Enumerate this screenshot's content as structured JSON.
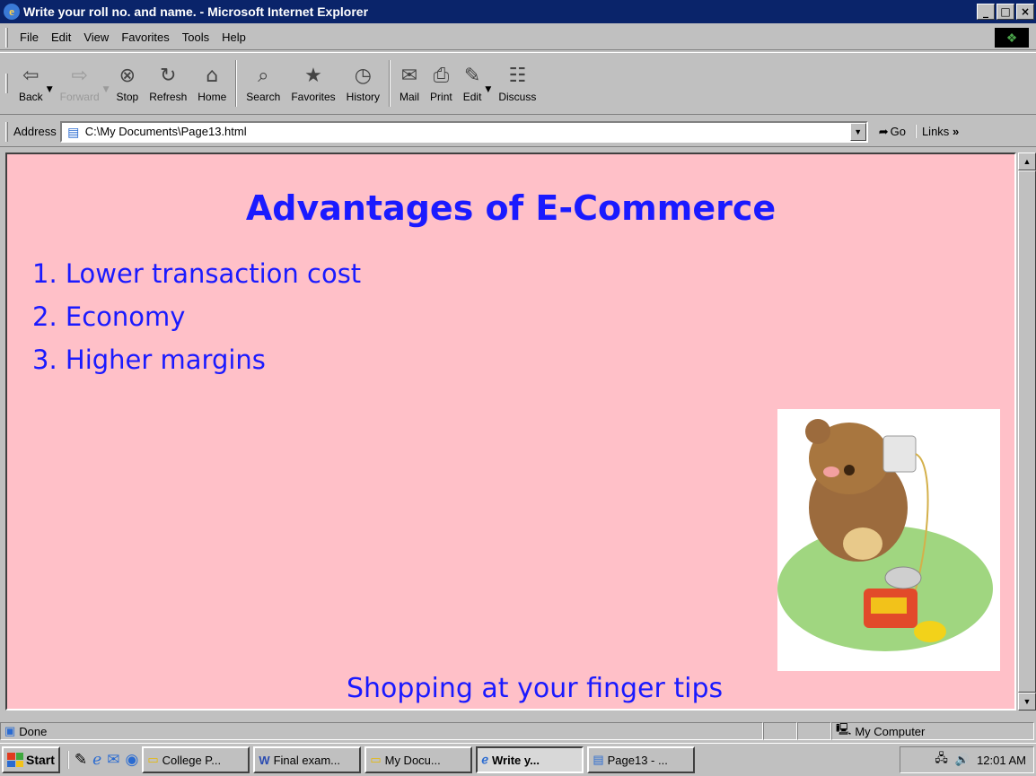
{
  "window": {
    "title": "Write your roll no. and name. - Microsoft Internet Explorer",
    "controls": [
      "_",
      "□",
      "×"
    ]
  },
  "menu": {
    "items": [
      "File",
      "Edit",
      "View",
      "Favorites",
      "Tools",
      "Help"
    ]
  },
  "toolbar": {
    "back": "Back",
    "forward": "Forward",
    "stop": "Stop",
    "refresh": "Refresh",
    "home": "Home",
    "search": "Search",
    "favorites": "Favorites",
    "history": "History",
    "mail": "Mail",
    "print": "Print",
    "edit": "Edit",
    "discuss": "Discuss"
  },
  "address": {
    "label": "Address",
    "value": "C:\\My Documents\\Page13.html",
    "go": "Go",
    "links": "Links"
  },
  "page": {
    "title": "Advantages of E-Commerce",
    "items": [
      "1. Lower transaction cost",
      "2. Economy",
      "3. Higher margins"
    ],
    "footer": "Shopping at your finger tips"
  },
  "status": {
    "text": "Done",
    "zone": "My Computer"
  },
  "taskbar": {
    "start": "Start",
    "tasks": [
      "College P...",
      "Final exam...",
      "My Docu...",
      "Write y...",
      "Page13 - ..."
    ],
    "clock": "12:01 AM"
  },
  "colors": {
    "page_background": "#ffc0c8",
    "text_blue": "#1a1aff",
    "titlebar": "#0a246a"
  }
}
